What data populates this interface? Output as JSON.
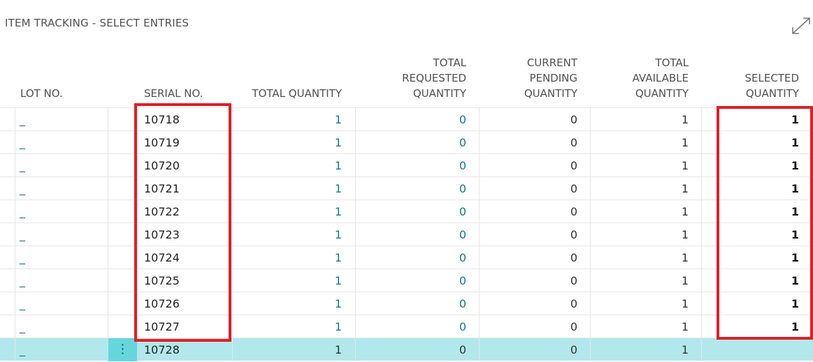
{
  "page": {
    "title": "ITEM TRACKING - SELECT ENTRIES"
  },
  "toolbar": {
    "expand_icon": "expand-icon"
  },
  "columns": {
    "lot_no": "LOT NO.",
    "serial_no": "SERIAL NO.",
    "total_quantity": "TOTAL QUANTITY",
    "total_requested_quantity": [
      "TOTAL",
      "REQUESTED",
      "QUANTITY"
    ],
    "current_pending_quantity": [
      "CURRENT",
      "PENDING",
      "QUANTITY"
    ],
    "total_available_quantity": [
      "TOTAL",
      "AVAILABLE",
      "QUANTITY"
    ],
    "selected_quantity": [
      "SELECTED",
      "QUANTITY"
    ]
  },
  "rows": [
    {
      "lot": "_",
      "serial": "10718",
      "total_qty": "1",
      "requested": "0",
      "pending": "0",
      "available": "1",
      "selected": "1"
    },
    {
      "lot": "_",
      "serial": "10719",
      "total_qty": "1",
      "requested": "0",
      "pending": "0",
      "available": "1",
      "selected": "1"
    },
    {
      "lot": "_",
      "serial": "10720",
      "total_qty": "1",
      "requested": "0",
      "pending": "0",
      "available": "1",
      "selected": "1"
    },
    {
      "lot": "_",
      "serial": "10721",
      "total_qty": "1",
      "requested": "0",
      "pending": "0",
      "available": "1",
      "selected": "1"
    },
    {
      "lot": "_",
      "serial": "10722",
      "total_qty": "1",
      "requested": "0",
      "pending": "0",
      "available": "1",
      "selected": "1"
    },
    {
      "lot": "_",
      "serial": "10723",
      "total_qty": "1",
      "requested": "0",
      "pending": "0",
      "available": "1",
      "selected": "1"
    },
    {
      "lot": "_",
      "serial": "10724",
      "total_qty": "1",
      "requested": "0",
      "pending": "0",
      "available": "1",
      "selected": "1"
    },
    {
      "lot": "_",
      "serial": "10725",
      "total_qty": "1",
      "requested": "0",
      "pending": "0",
      "available": "1",
      "selected": "1"
    },
    {
      "lot": "_",
      "serial": "10726",
      "total_qty": "1",
      "requested": "0",
      "pending": "0",
      "available": "1",
      "selected": "1"
    },
    {
      "lot": "_",
      "serial": "10727",
      "total_qty": "1",
      "requested": "0",
      "pending": "0",
      "available": "1",
      "selected": "1"
    },
    {
      "lot": "_",
      "serial": "10728",
      "total_qty": "1",
      "requested": "0",
      "pending": "0",
      "available": "1",
      "selected": ""
    }
  ],
  "active_row": {
    "menu_glyph": "⋮"
  },
  "colors": {
    "accent": "#0a7f84",
    "selected_row": "#b2e8eb",
    "row_menu": "#66d6dd",
    "highlight": "#e01e25"
  }
}
